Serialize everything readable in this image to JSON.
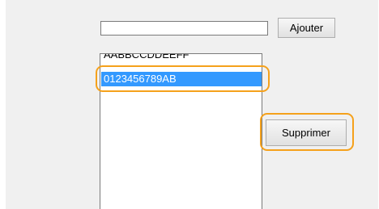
{
  "form": {
    "input_value": "",
    "add_label": "Ajouter",
    "remove_label": "Supprimer"
  },
  "list": {
    "items": [
      "AABBCCDDEEFF",
      "0123456789AB"
    ],
    "selected_index": 1
  },
  "colors": {
    "selection": "#3399ff",
    "highlight": "#f5a11b"
  }
}
